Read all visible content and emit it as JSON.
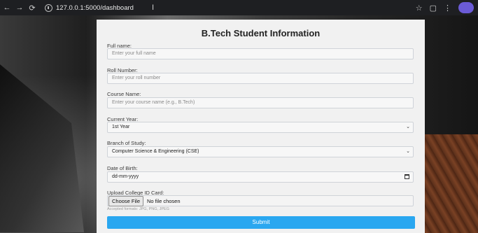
{
  "browser": {
    "url": "127.0.0.1:5000/dashboard",
    "back_icon": "arrow-left",
    "forward_icon": "arrow-right",
    "reload_icon": "reload"
  },
  "form": {
    "title": "B.Tech Student Information",
    "fields": [
      {
        "label": "Full name:",
        "placeholder": "Enter your full name"
      },
      {
        "label": "Roll Number:",
        "placeholder": "Enter your roll number"
      },
      {
        "label": "Course Name:",
        "placeholder": "Enter your course name (e.g., B.Tech)"
      },
      {
        "label": "Current Year:",
        "value": "1st Year"
      },
      {
        "label": "Branch of Study:",
        "value": "Computer Science & Engineering (CSE)"
      },
      {
        "label": "Date of Birth:",
        "placeholder": "dd-mm-yyyy"
      },
      {
        "label": "Upload College ID Card:",
        "button": "Choose File",
        "status": "No file chosen",
        "hint": "Accepted formats: JPG, PNG, JPEG"
      }
    ],
    "submit_label": "Submit"
  },
  "colors": {
    "accent": "#2aa7f0"
  }
}
